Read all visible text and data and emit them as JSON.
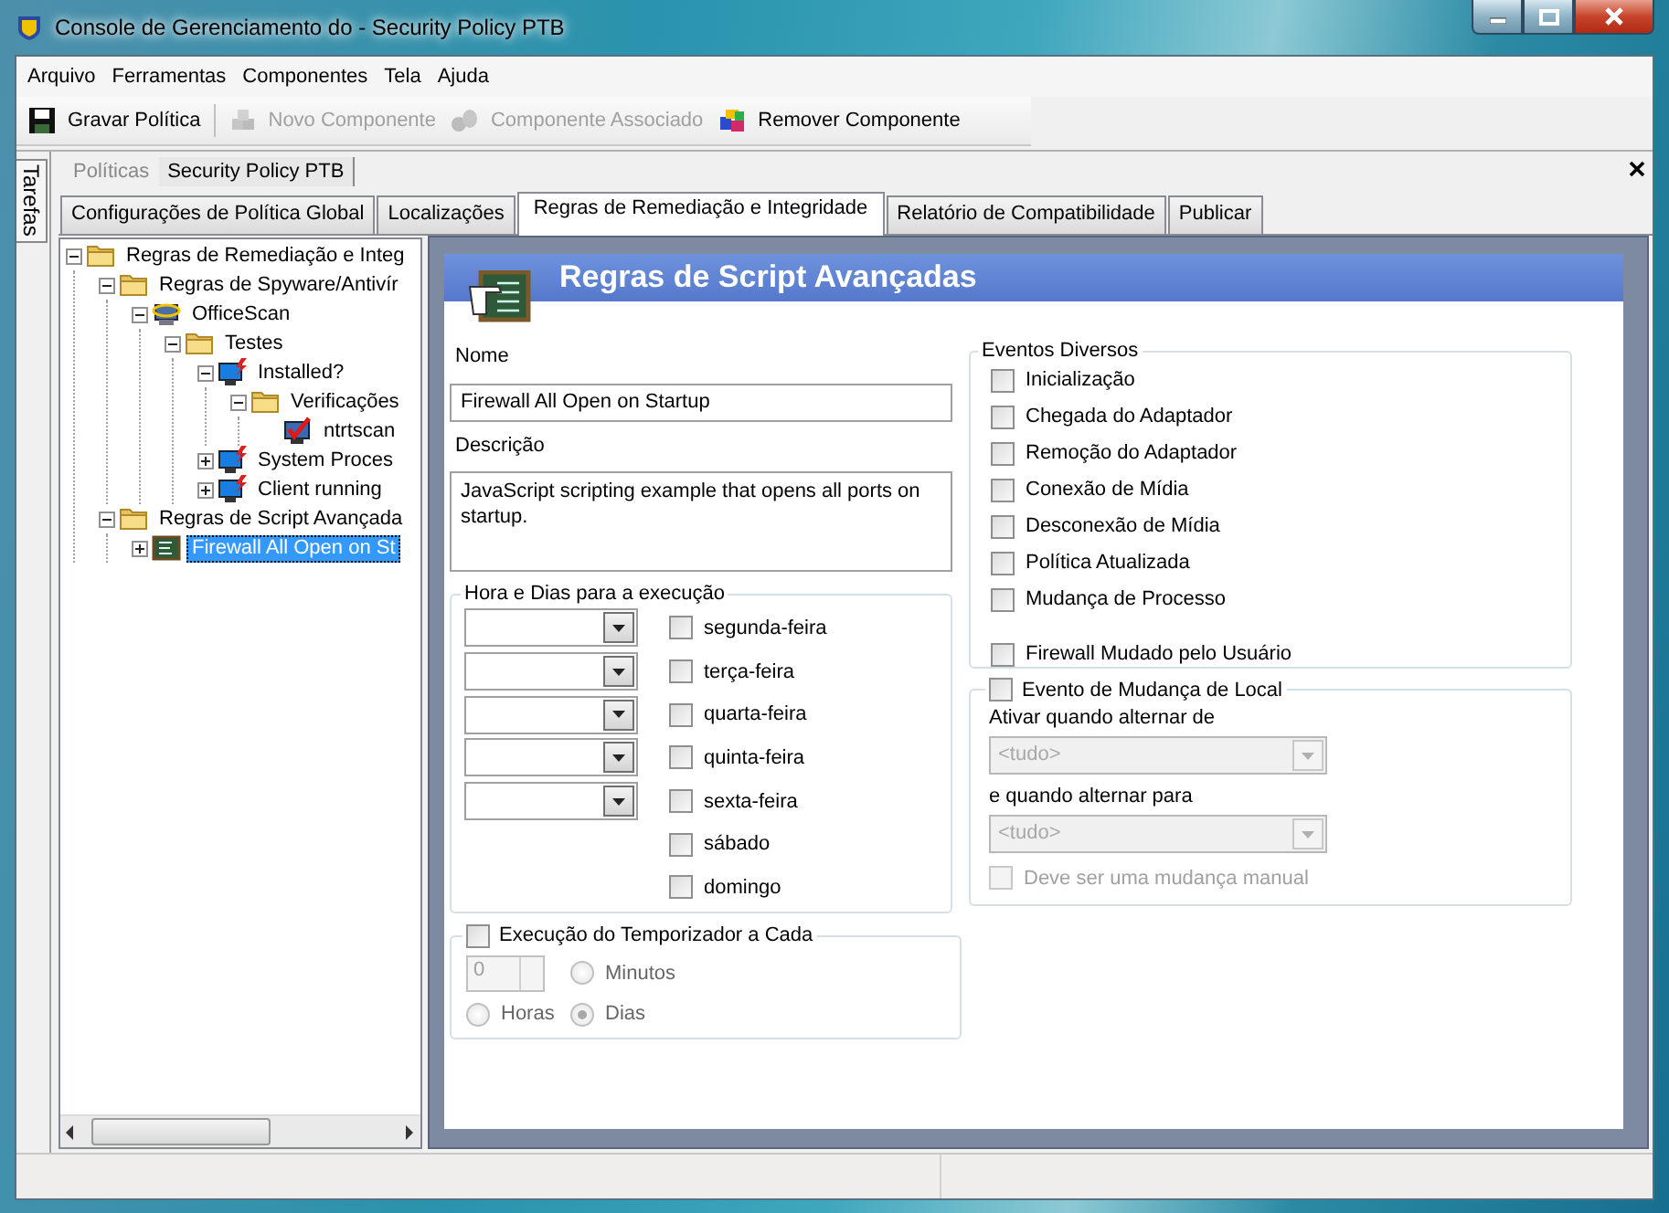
{
  "window": {
    "title": "Console de Gerenciamento do  - Security Policy PTB"
  },
  "menu": [
    "Arquivo",
    "Ferramentas",
    "Componentes",
    "Tela",
    "Ajuda"
  ],
  "toolbar": [
    [
      {
        "label": "Gravar Política",
        "kind": "save",
        "disabled": false
      }
    ],
    [
      {
        "label": "Novo Componente",
        "kind": "new",
        "disabled": true
      },
      {
        "label": "Componente Associado",
        "kind": "associate",
        "disabled": true
      },
      {
        "label": "Remover Componente",
        "kind": "remove",
        "disabled": false
      }
    ]
  ],
  "side_tab": "Tarefas",
  "breadcrumb": [
    {
      "label": "Políticas",
      "selected": false
    },
    {
      "label": "Security Policy PTB",
      "selected": true
    }
  ],
  "tabs": [
    {
      "label": "Configurações de Política Global",
      "selected": false
    },
    {
      "label": "Localizações",
      "selected": false
    },
    {
      "label": "Regras de Remediação e Integridade",
      "selected": true
    },
    {
      "label": "Relatório de Compatibilidade",
      "selected": false
    },
    {
      "label": "Publicar",
      "selected": false
    }
  ],
  "tree": [
    {
      "label": "Regras de Remediação e Integ",
      "kind": "folder",
      "expanded": true,
      "selected": false,
      "children": [
        {
          "label": "Regras de Spyware/Antivír",
          "kind": "folder",
          "expanded": true,
          "selected": false,
          "children": [
            {
              "label": "OfficeScan",
              "kind": "scanner",
              "expanded": true,
              "selected": false,
              "children": [
                {
                  "label": "Testes",
                  "kind": "folder",
                  "expanded": true,
                  "selected": false,
                  "children": [
                    {
                      "label": "Installed?",
                      "kind": "monitor",
                      "expanded": true,
                      "selected": false,
                      "children": [
                        {
                          "label": "Verificações",
                          "kind": "folder",
                          "expanded": true,
                          "selected": false,
                          "children": [
                            {
                              "label": "ntrtscan",
                              "kind": "check",
                              "selected": false
                            }
                          ]
                        }
                      ]
                    },
                    {
                      "label": "System Proces",
                      "kind": "monitor",
                      "expanded": false,
                      "selected": false
                    },
                    {
                      "label": "Client running",
                      "kind": "monitor",
                      "expanded": false,
                      "selected": false
                    }
                  ]
                }
              ]
            }
          ]
        },
        {
          "label": "Regras de Script Avançada",
          "kind": "folder",
          "expanded": true,
          "selected": false,
          "children": [
            {
              "label": "Firewall All Open on St",
              "kind": "script",
              "expanded": false,
              "selected": true
            }
          ]
        }
      ]
    }
  ],
  "panel": {
    "title": "Regras de Script Avançadas",
    "name_label": "Nome",
    "name_value": "Firewall All Open on Startup",
    "description_label": "Descrição",
    "description_value": "JavaScript scripting example that opens all ports on startup.",
    "schedule": {
      "title": "Hora e Dias para a execução",
      "days": [
        {
          "label": "segunda-feira",
          "checked": false,
          "time_field": true
        },
        {
          "label": "terça-feira",
          "checked": false,
          "time_field": true
        },
        {
          "label": "quarta-feira",
          "checked": false,
          "time_field": true
        },
        {
          "label": "quinta-feira",
          "checked": false,
          "time_field": true
        },
        {
          "label": "sexta-feira",
          "checked": false,
          "time_field": true
        },
        {
          "label": "sábado",
          "checked": false,
          "time_field": false
        },
        {
          "label": "domingo",
          "checked": false,
          "time_field": false
        }
      ]
    },
    "timer": {
      "label": "Execução do Temporizador a Cada",
      "checked": false,
      "disabled": true,
      "interval": "0",
      "units": [
        {
          "label": "Minutos",
          "selected": false
        },
        {
          "label": "Horas",
          "selected": false
        },
        {
          "label": "Dias",
          "selected": true
        }
      ]
    },
    "events": {
      "title": "Eventos Diversos",
      "items": [
        {
          "label": "Inicialização",
          "checked": false
        },
        {
          "label": "Chegada do Adaptador",
          "checked": false
        },
        {
          "label": "Remoção do Adaptador",
          "checked": false
        },
        {
          "label": "Conexão de Mídia",
          "checked": false
        },
        {
          "label": "Desconexão de Mídia",
          "checked": false
        },
        {
          "label": "Política Atualizada",
          "checked": false
        },
        {
          "label": "Mudança de Processo",
          "checked": false
        }
      ],
      "user_items": [
        {
          "label": "Firewall Mudado pelo Usuário",
          "checked": false
        }
      ]
    },
    "location": {
      "label": "Evento de Mudança de Local",
      "checked": false,
      "disabled": true,
      "from_label": "Ativar quando alternar de",
      "from_value": "<tudo>",
      "to_label": "e quando alternar para",
      "to_value": "<tudo>",
      "manual": {
        "label": "Deve ser uma mudança manual",
        "checked": false
      }
    }
  }
}
